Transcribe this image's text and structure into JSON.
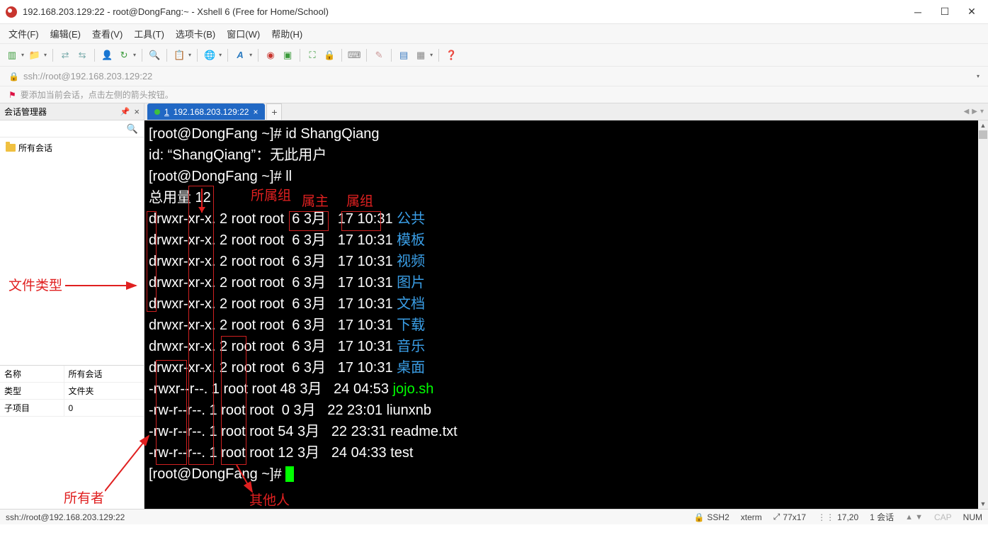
{
  "window": {
    "title": "192.168.203.129:22 - root@DongFang:~ - Xshell 6 (Free for Home/School)"
  },
  "menu": [
    "文件(F)",
    "编辑(E)",
    "查看(V)",
    "工具(T)",
    "选项卡(B)",
    "窗口(W)",
    "帮助(H)"
  ],
  "addr": "ssh://root@192.168.203.129:22",
  "hint": "要添加当前会话，点击左侧的箭头按钮。",
  "sidebar": {
    "title": "会话管理器",
    "root": "所有会话",
    "props": [
      {
        "k": "名称",
        "v": "所有会话"
      },
      {
        "k": "类型",
        "v": "文件夹"
      },
      {
        "k": "子项目",
        "v": "0"
      }
    ]
  },
  "tab": {
    "index": "1",
    "label": "192.168.203.129:22"
  },
  "terminal": {
    "prompt": "[root@DongFang ~]# ",
    "cmd1": "id ShangQiang",
    "resp1": "id: “ShangQiang”：无此用户",
    "cmd2": "ll",
    "total": "总用量 12",
    "rows": [
      {
        "perm": "drwxr-xr-x.",
        "n": "2",
        "own": "root",
        "grp": "root",
        "sz": " 6",
        "mo": "3月",
        "d": "17",
        "t": "10:31",
        "name": "公共",
        "cls": "c-blue"
      },
      {
        "perm": "drwxr-xr-x.",
        "n": "2",
        "own": "root",
        "grp": "root",
        "sz": " 6",
        "mo": "3月",
        "d": "17",
        "t": "10:31",
        "name": "模板",
        "cls": "c-blue"
      },
      {
        "perm": "drwxr-xr-x.",
        "n": "2",
        "own": "root",
        "grp": "root",
        "sz": " 6",
        "mo": "3月",
        "d": "17",
        "t": "10:31",
        "name": "视频",
        "cls": "c-blue"
      },
      {
        "perm": "drwxr-xr-x.",
        "n": "2",
        "own": "root",
        "grp": "root",
        "sz": " 6",
        "mo": "3月",
        "d": "17",
        "t": "10:31",
        "name": "图片",
        "cls": "c-blue"
      },
      {
        "perm": "drwxr-xr-x.",
        "n": "2",
        "own": "root",
        "grp": "root",
        "sz": " 6",
        "mo": "3月",
        "d": "17",
        "t": "10:31",
        "name": "文档",
        "cls": "c-blue"
      },
      {
        "perm": "drwxr-xr-x.",
        "n": "2",
        "own": "root",
        "grp": "root",
        "sz": " 6",
        "mo": "3月",
        "d": "17",
        "t": "10:31",
        "name": "下载",
        "cls": "c-blue"
      },
      {
        "perm": "drwxr-xr-x.",
        "n": "2",
        "own": "root",
        "grp": "root",
        "sz": " 6",
        "mo": "3月",
        "d": "17",
        "t": "10:31",
        "name": "音乐",
        "cls": "c-blue"
      },
      {
        "perm": "drwxr-xr-x.",
        "n": "2",
        "own": "root",
        "grp": "root",
        "sz": " 6",
        "mo": "3月",
        "d": "17",
        "t": "10:31",
        "name": "桌面",
        "cls": "c-blue"
      },
      {
        "perm": "-rwxr--r--.",
        "n": "1",
        "own": "root",
        "grp": "root",
        "sz": "48",
        "mo": "3月",
        "d": "24",
        "t": "04:53",
        "name": "jojo.sh",
        "cls": "c-green"
      },
      {
        "perm": "-rw-r--r--.",
        "n": "1",
        "own": "root",
        "grp": "root",
        "sz": " 0",
        "mo": "3月",
        "d": "22",
        "t": "23:01",
        "name": "liunxnb",
        "cls": ""
      },
      {
        "perm": "-rw-r--r--.",
        "n": "1",
        "own": "root",
        "grp": "root",
        "sz": "54",
        "mo": "3月",
        "d": "22",
        "t": "23:31",
        "name": "readme.txt",
        "cls": ""
      },
      {
        "perm": "-rw-r--r--.",
        "n": "1",
        "own": "root",
        "grp": "root",
        "sz": "12",
        "mo": "3月",
        "d": "24",
        "t": "04:33",
        "name": "test",
        "cls": ""
      }
    ]
  },
  "annotations": {
    "group": "所属组",
    "owner_col": "属主",
    "group_col": "属组",
    "file_type": "文件类型",
    "owner": "所有者",
    "other": "其他人"
  },
  "status": {
    "url": "ssh://root@192.168.203.129:22",
    "proto": "SSH2",
    "term": "xterm",
    "size": "77x17",
    "pos": "17,20",
    "sess": "1 会话",
    "cap": "CAP",
    "num": "NUM"
  }
}
